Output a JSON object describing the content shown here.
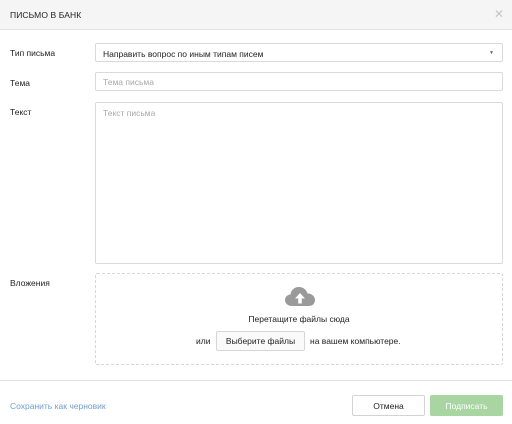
{
  "dialog": {
    "title": "ПИСЬМО В БАНК",
    "close_icon": "close-icon"
  },
  "form": {
    "letter_type": {
      "label": "Тип письма",
      "value": "Направить вопрос по иным типам писем",
      "icon": "caret-down-icon"
    },
    "subject": {
      "label": "Тема",
      "value": "",
      "placeholder": "Тема письма"
    },
    "text": {
      "label": "Текст",
      "value": "",
      "placeholder": "Текст письма"
    },
    "attachments": {
      "label": "Вложения",
      "icon": "cloud-upload-icon",
      "drop_text": "Перетащите файлы сюда",
      "or_text": "или",
      "choose_button": "Выберите файлы",
      "suffix_text": "на вашем компьютере."
    }
  },
  "footer": {
    "save_draft": "Сохранить как черновик",
    "cancel": "Отмена",
    "sign": "Подписать",
    "sign_enabled": false
  },
  "colors": {
    "link": "#6f9ecf",
    "sign_button_disabled": "#a8d5a2",
    "header_bg": "#f5f5f5",
    "border": "#dadada"
  }
}
